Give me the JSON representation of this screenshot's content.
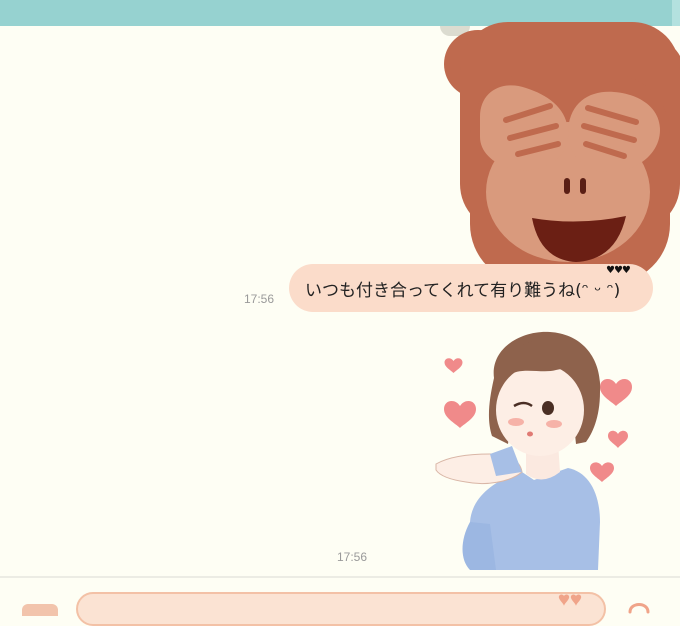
{
  "chat": {
    "messages": [
      {
        "type": "sticker",
        "icon": "monkey-covering-eyes-sticker"
      },
      {
        "type": "text",
        "text": "いつも付き合ってくれて有り難うね(ᵔ ᵕ ᵔ)",
        "time": "17:56",
        "hearts": "♥♥♥"
      },
      {
        "type": "sticker",
        "icon": "girl-blowing-kiss-sticker",
        "time": "17:56"
      }
    ]
  },
  "composer": {
    "placeholder": "",
    "value": ""
  },
  "colors": {
    "header": "#96d2d0",
    "background": "#fefef4",
    "bubble": "#fbdcca",
    "input": "#fbe3d3"
  }
}
